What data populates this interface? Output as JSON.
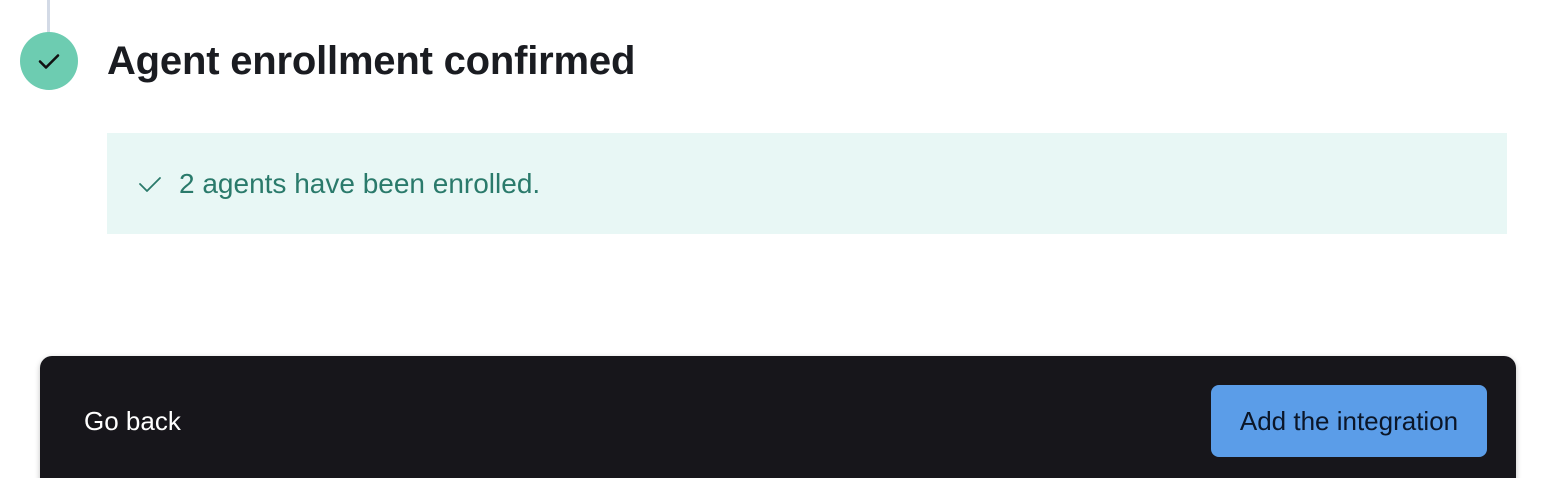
{
  "step": {
    "title": "Agent enrollment confirmed",
    "status_icon": "check-icon",
    "status_color": "#6dccb1"
  },
  "callout": {
    "icon": "check-icon",
    "message": "2 agents have been enrolled.",
    "background_color": "#e8f7f5",
    "text_color": "#2a7a6b"
  },
  "bottom_bar": {
    "back_label": "Go back",
    "primary_label": "Add the integration",
    "background_color": "#17161b",
    "primary_color": "#5b9de8"
  }
}
